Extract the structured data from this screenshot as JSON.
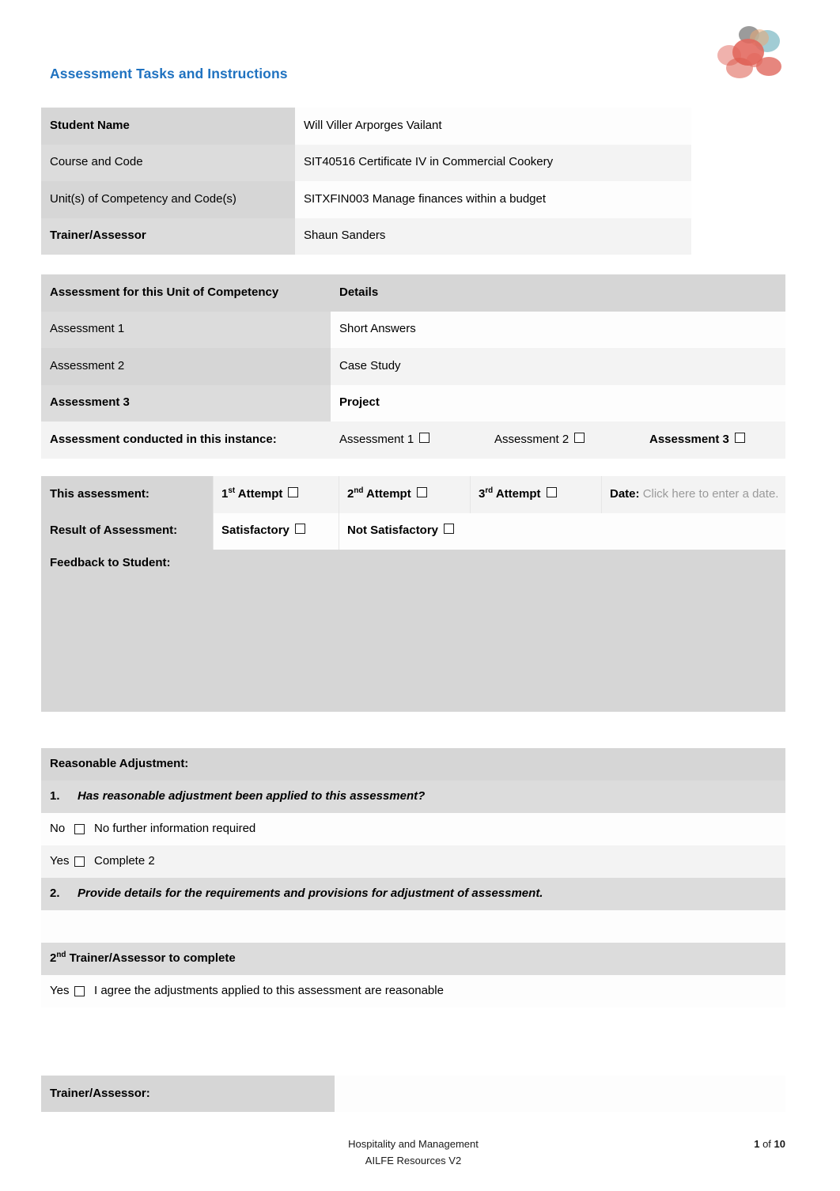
{
  "document": {
    "title": "Assessment Tasks and Instructions",
    "title_color": "#1F72C0"
  },
  "logo": {
    "name": "organisation-logo",
    "colors": [
      "#E05A4E",
      "#D94A3D",
      "#7FB9C4",
      "#6E6E6E",
      "#E8A06A"
    ]
  },
  "student_details": {
    "rows": [
      {
        "label": "Student Name",
        "value": "Will Viller Arporges Vailant"
      },
      {
        "label": "Course and Code",
        "value": "SIT40516 Certificate IV in Commercial Cookery"
      },
      {
        "label": "Unit(s) of Competency and Code(s)",
        "value": "SITXFIN003 Manage finances within a budget"
      },
      {
        "label": "Trainer/Assessor",
        "value": "Shaun Sanders"
      }
    ]
  },
  "assessment_table": {
    "header": {
      "col1": "Assessment for this Unit of Competency",
      "col2": "Details"
    },
    "rows": [
      {
        "label": "Assessment 1",
        "detail": "Short Answers"
      },
      {
        "label": "Assessment 2",
        "detail": "Case Study"
      },
      {
        "label": "Assessment 3",
        "detail": "Project"
      }
    ],
    "conducted_label": "Assessment conducted in this instance:",
    "conducted_options": [
      {
        "label": "Assessment 1",
        "checked": false
      },
      {
        "label": "Assessment 2",
        "checked": false
      },
      {
        "label": "Assessment 3",
        "checked": false
      }
    ]
  },
  "result_table": {
    "this_assessment_label": "This assessment:",
    "attempts": [
      {
        "ordinal": "1",
        "suffix": "st",
        "label": "Attempt",
        "checked": false
      },
      {
        "ordinal": "2",
        "suffix": "nd",
        "label": "Attempt",
        "checked": false
      },
      {
        "ordinal": "3",
        "suffix": "rd",
        "label": "Attempt",
        "checked": false
      }
    ],
    "date_label": "Date:",
    "date_placeholder": "Click here to enter a date.",
    "result_label": "Result of Assessment:",
    "result_options": [
      {
        "label": "Satisfactory",
        "checked": false
      },
      {
        "label": "Not Satisfactory",
        "checked": false
      }
    ],
    "feedback_label": "Feedback to Student:",
    "feedback_value": ""
  },
  "reasonable_adjustment": {
    "heading": "Reasonable Adjustment:",
    "question_1_number": "1.",
    "question_1": "Has reasonable adjustment been applied to this assessment?",
    "option_no_word": "No",
    "option_no_text": "No further information required",
    "option_yes_word": "Yes",
    "option_yes_text": "Complete 2",
    "question_2_number": "2.",
    "question_2": "Provide details for the requirements and provisions for adjustment of assessment.",
    "details_value": "",
    "second_assessor_prefix": "2",
    "second_assessor_suffix": "nd",
    "second_assessor_heading": "Trainer/Assessor to complete",
    "agree_word": "Yes",
    "agree_text": "I agree the adjustments applied to this assessment are reasonable",
    "signature_label": "Trainer/Assessor:",
    "signature_value": ""
  },
  "footer": {
    "line1": "Hospitality and Management",
    "line2": "AILFE Resources V2",
    "page_current": "1",
    "page_of": "of",
    "page_total": "10"
  }
}
